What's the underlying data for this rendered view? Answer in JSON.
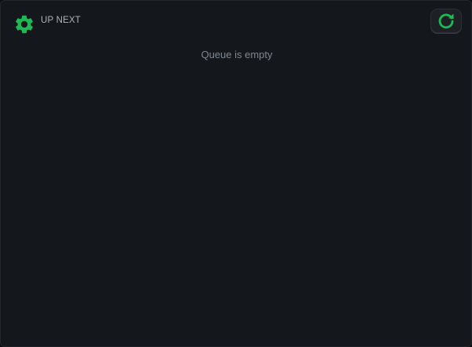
{
  "header": {
    "settings_icon": "gear-icon",
    "title": "UP NEXT",
    "refresh_icon": "refresh-icon"
  },
  "queue": {
    "empty_message": "Queue is empty"
  },
  "colors": {
    "accent": "#1db954",
    "background": "#14171b"
  }
}
